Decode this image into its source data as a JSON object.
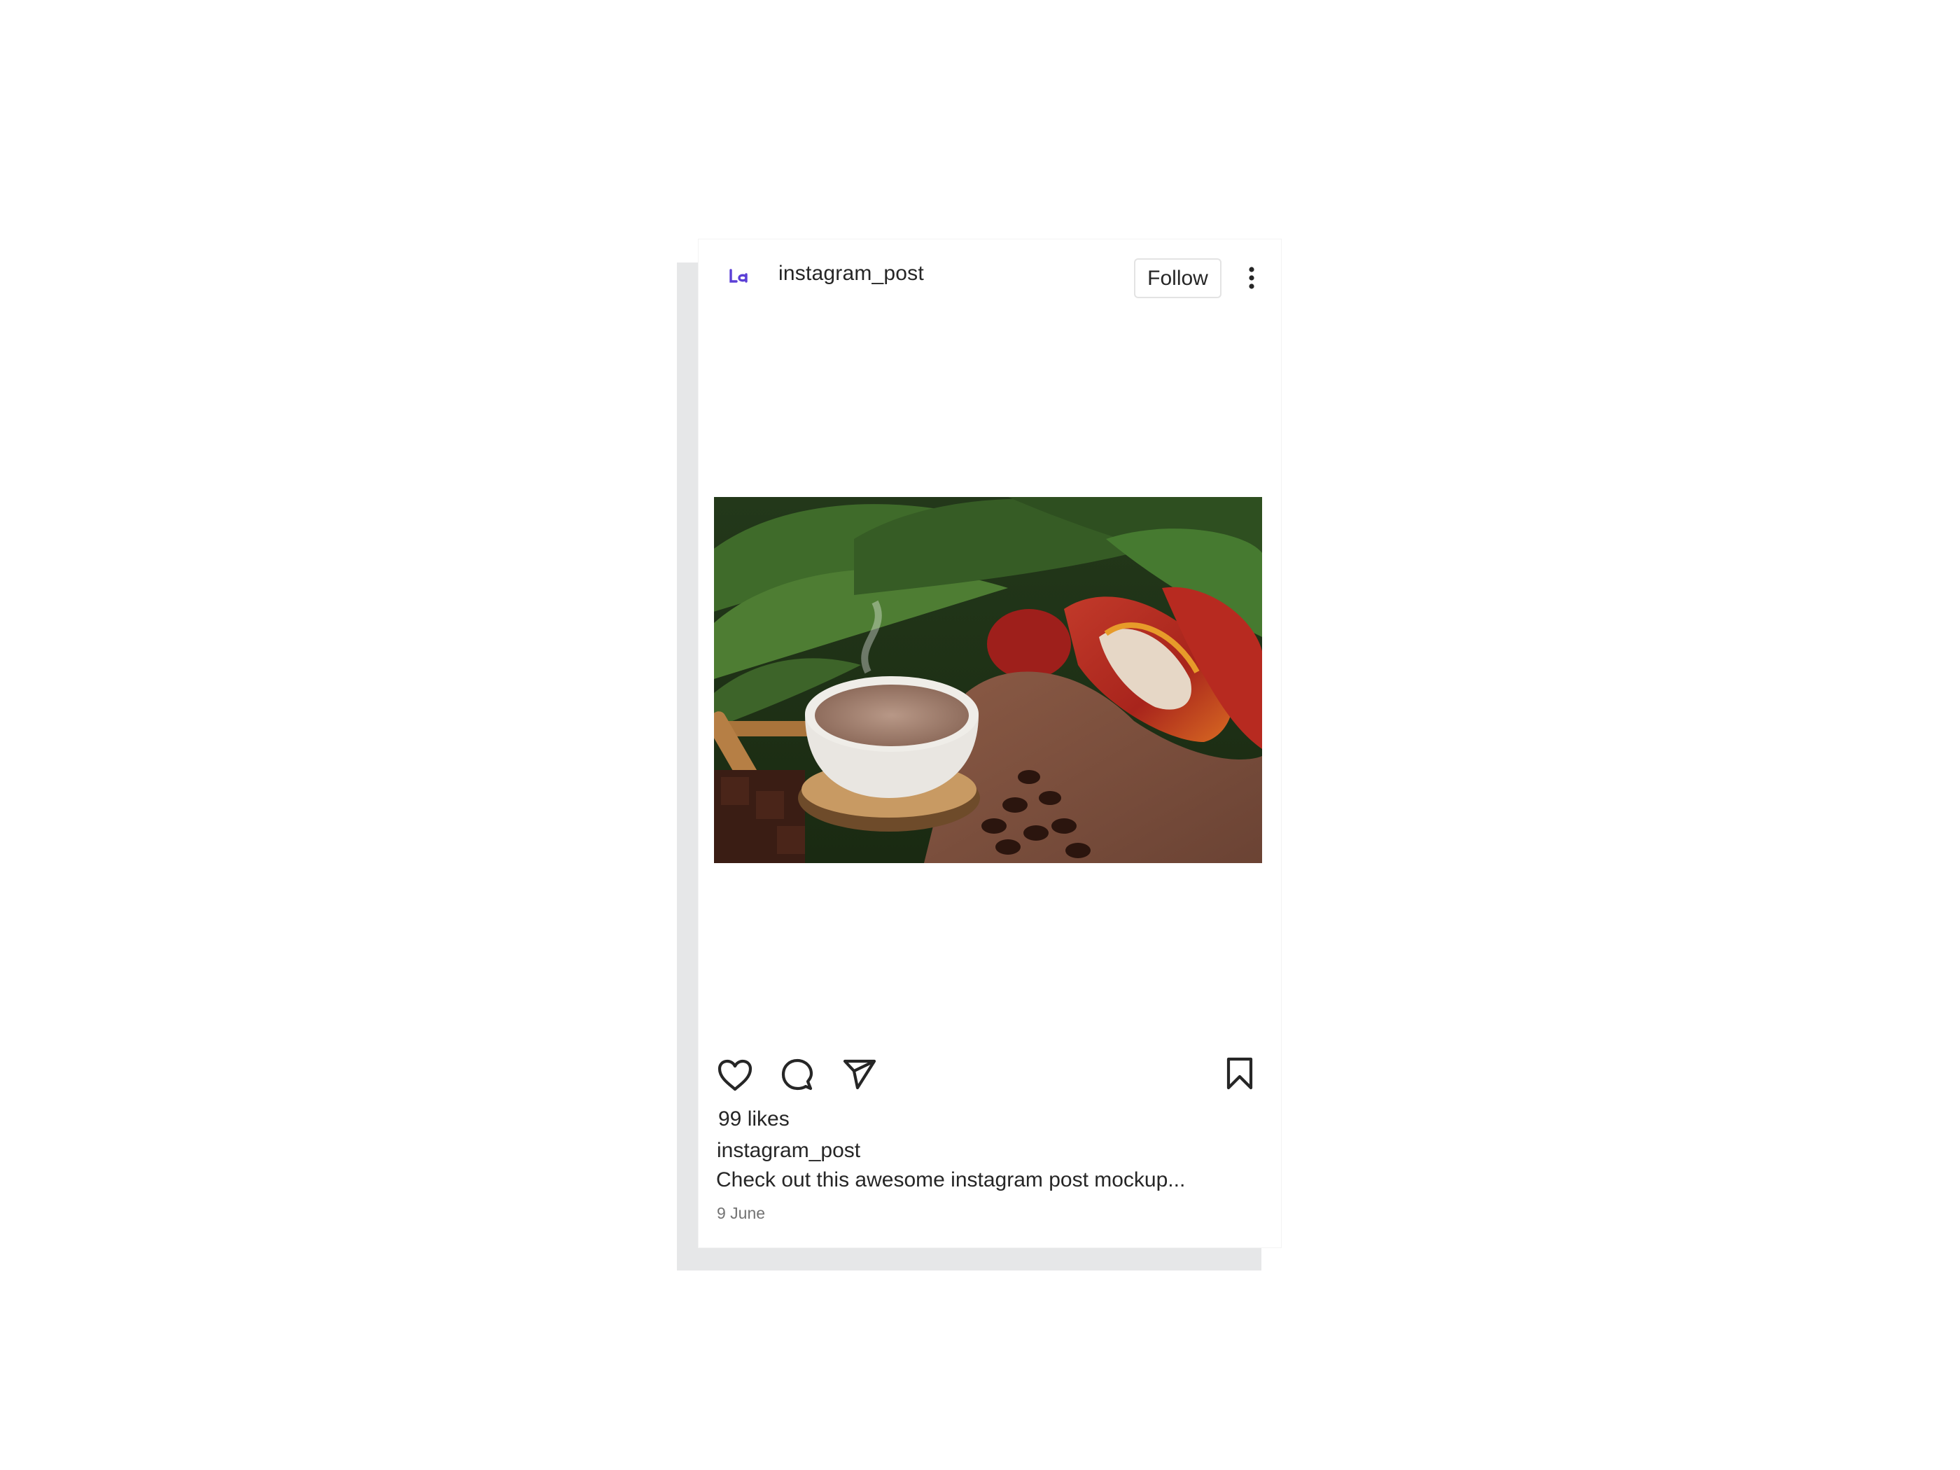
{
  "post": {
    "username": "instagram_post",
    "follow_label": "Follow",
    "likes": "99 likes",
    "caption_username": "instagram_post",
    "caption": "Check out this awesome instagram post mockup...",
    "date": "9 June"
  },
  "icons": {
    "avatar": "logo-icon",
    "more": "more-vertical-icon",
    "like": "heart-icon",
    "comment": "comment-icon",
    "share": "send-icon",
    "save": "bookmark-icon"
  },
  "colors": {
    "accent": "#5b3fd6",
    "text": "#262626",
    "muted": "#737373",
    "frame": "#e6e7e8"
  }
}
